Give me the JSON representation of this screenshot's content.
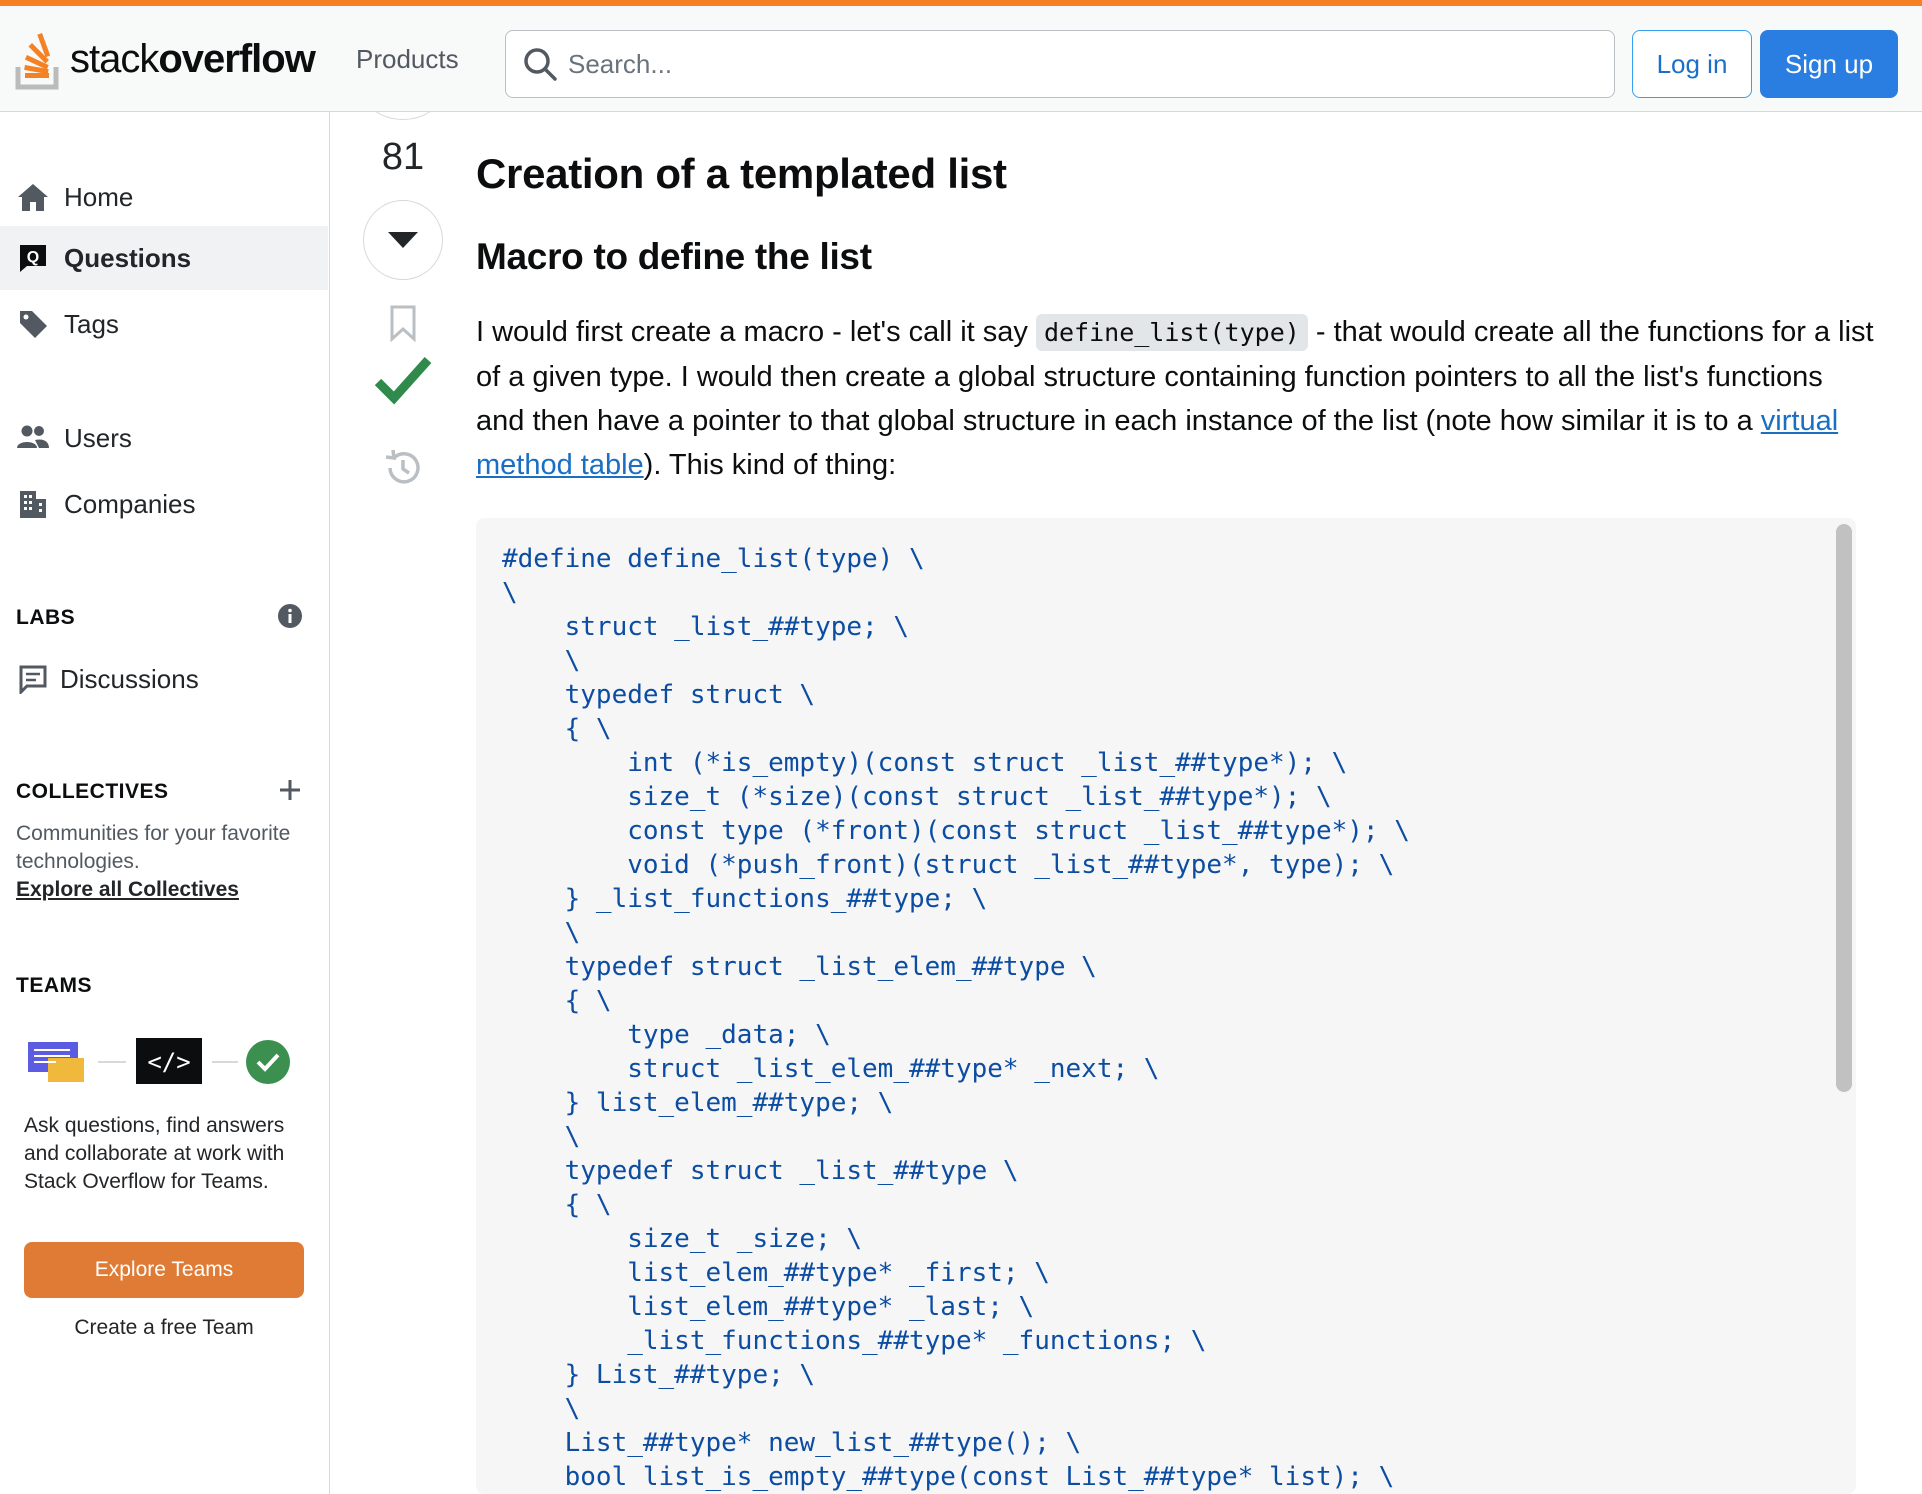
{
  "header": {
    "logo_light": "stack",
    "logo_bold": "overflow",
    "products_label": "Products",
    "search_placeholder": "Search...",
    "login_label": "Log in",
    "signup_label": "Sign up"
  },
  "sidebar": {
    "items": [
      {
        "label": "Home",
        "icon": "home-icon"
      },
      {
        "label": "Questions",
        "icon": "questions-icon",
        "active": true
      },
      {
        "label": "Tags",
        "icon": "tag-icon"
      },
      {
        "label": "Users",
        "icon": "users-icon"
      },
      {
        "label": "Companies",
        "icon": "companies-icon"
      }
    ],
    "labs_title": "LABS",
    "discussions_label": "Discussions",
    "collectives_title": "COLLECTIVES",
    "collectives_desc": "Communities for your favorite technologies.",
    "collectives_link": "Explore all Collectives",
    "teams_title": "TEAMS",
    "teams_desc": "Ask questions, find answers and collaborate at work with Stack Overflow for Teams.",
    "explore_teams_label": "Explore Teams",
    "create_team_label": "Create a free Team"
  },
  "post": {
    "vote_count": "81",
    "heading1": "Creation of a templated list",
    "heading2": "Macro to define the list",
    "para_part1": "I would first create a macro - let's call it say ",
    "para_code": "define_list(type)",
    "para_part2": " - that would create all the functions for a list of a given type. I would then create a global structure containing function pointers to all the list's functions and then have a pointer to that global structure in each instance of the list (note how similar it is to a ",
    "para_link": "virtual method table",
    "para_part3": "). This kind of thing:",
    "code": "#define define_list(type) \\\n\\\n    struct _list_##type; \\\n    \\\n    typedef struct \\\n    { \\\n        int (*is_empty)(const struct _list_##type*); \\\n        size_t (*size)(const struct _list_##type*); \\\n        const type (*front)(const struct _list_##type*); \\\n        void (*push_front)(struct _list_##type*, type); \\\n    } _list_functions_##type; \\\n    \\\n    typedef struct _list_elem_##type \\\n    { \\\n        type _data; \\\n        struct _list_elem_##type* _next; \\\n    } list_elem_##type; \\\n    \\\n    typedef struct _list_##type \\\n    { \\\n        size_t _size; \\\n        list_elem_##type* _first; \\\n        list_elem_##type* _last; \\\n        _list_functions_##type* _functions; \\\n    } List_##type; \\\n    \\\n    List_##type* new_list_##type(); \\\n    bool list_is_empty_##type(const List_##type* list); \\"
  },
  "colors": {
    "accent_orange": "#f48225",
    "brand_blue": "#2a7de1",
    "accepted_green": "#2f8a4b",
    "code_blue": "#0c4da2",
    "teams_button": "#e07b35"
  }
}
